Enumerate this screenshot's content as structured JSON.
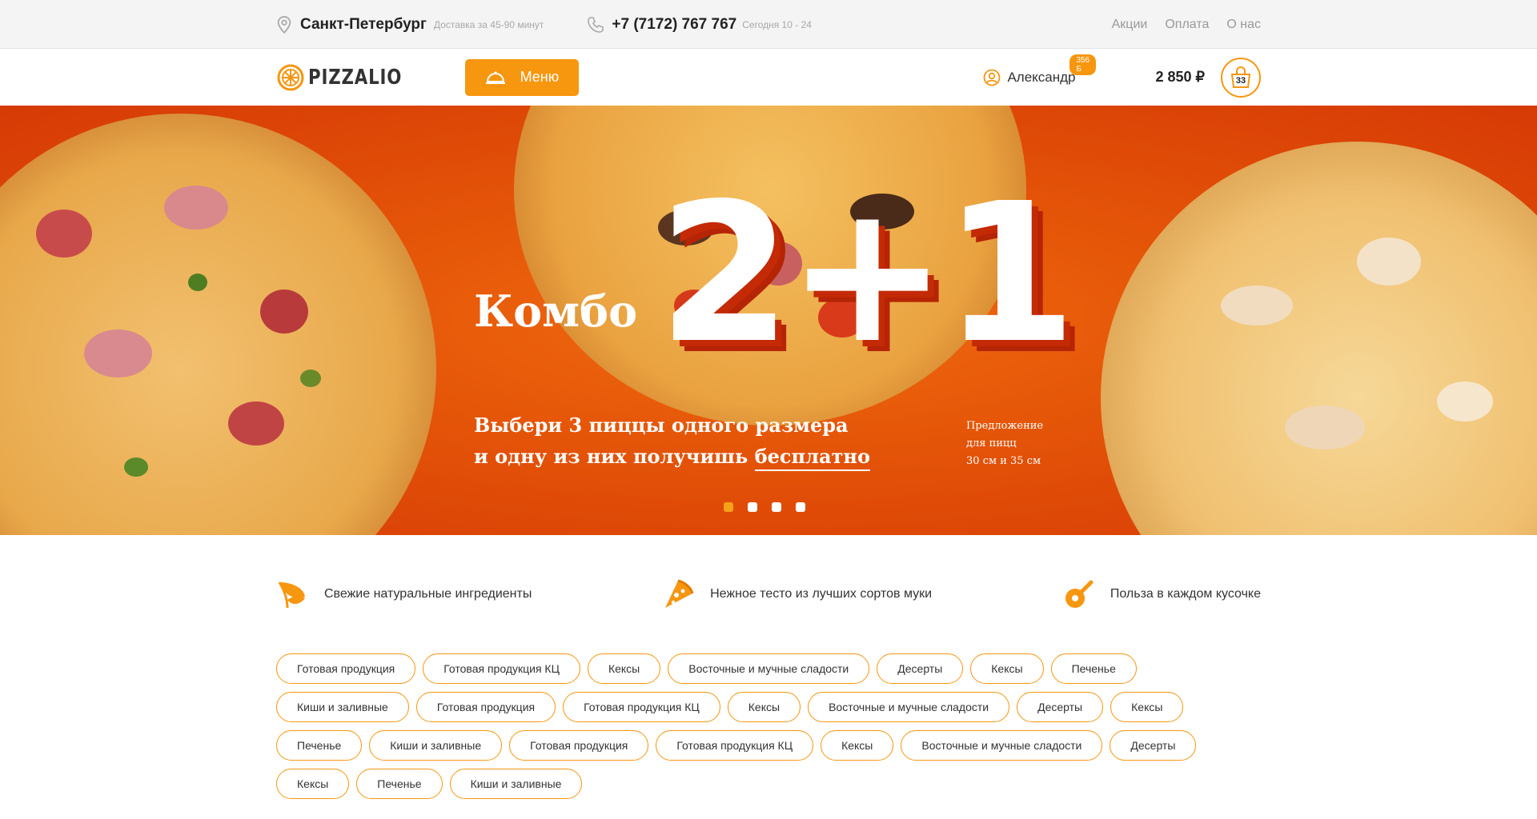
{
  "topbar": {
    "city": "Санкт-Петербург",
    "delivery": "Доставка за 45-90 минут",
    "phone": "+7 (7172) 767 767",
    "hours": "Сегодня 10 - 24",
    "links": [
      "Акции",
      "Оплата",
      "О нас"
    ]
  },
  "header": {
    "logo": "PIZZALIO",
    "menu_label": "Меню",
    "user_name": "Александр",
    "bonus": "356 Б",
    "total": "2 850 ₽",
    "cart_count": "33"
  },
  "hero": {
    "combo": "Комбо",
    "big": "2+1",
    "line1": "Выбери 3 пиццы одного размера",
    "line2_prefix": "и одну из них получишь ",
    "line2_highlight": "бесплатно",
    "offer_line1": "Предложение",
    "offer_line2": "для пицц",
    "offer_line3": "30 см и 35 см",
    "slides_total": 4,
    "slide_active": 1
  },
  "features": [
    {
      "icon": "leaf-icon",
      "label": "Свежие натуральные ингредиенты"
    },
    {
      "icon": "pizza-slice-icon",
      "label": "Нежное тесто из лучших сортов муки"
    },
    {
      "icon": "pizza-cutter-icon",
      "label": "Польза в каждом кусочке"
    }
  ],
  "tags": [
    "Готовая продукция",
    "Готовая продукция КЦ",
    "Кексы",
    "Восточные и мучные сладости",
    "Десерты",
    "Кексы",
    "Печенье",
    "Киши и заливные",
    "Готовая продукция",
    "Готовая продукция КЦ",
    "Кексы",
    "Восточные и мучные сладости",
    "Десерты",
    "Кексы",
    "Печенье",
    "Киши и заливные",
    "Готовая продукция",
    "Готовая продукция КЦ",
    "Кексы",
    "Восточные и мучные сладости",
    "Десерты",
    "Кексы",
    "Печенье",
    "Киши и заливные"
  ],
  "colors": {
    "accent": "#f7960f",
    "hero": "#e55608"
  }
}
